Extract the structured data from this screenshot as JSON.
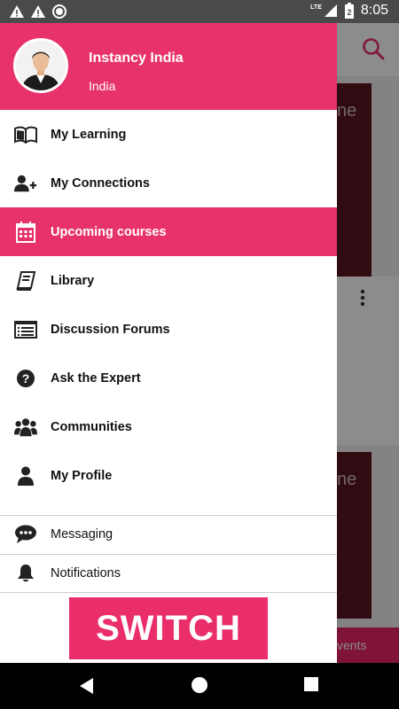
{
  "status_bar": {
    "time": "8:05",
    "network": "LTE",
    "battery_level_label": "2"
  },
  "user": {
    "name": "Instancy India",
    "location": "India"
  },
  "menu": {
    "items": [
      {
        "label": "My Learning",
        "icon": "book-open-icon",
        "active": false
      },
      {
        "label": "My Connections",
        "icon": "add-user-icon",
        "active": false
      },
      {
        "label": "Upcoming courses",
        "icon": "calendar-icon",
        "active": true
      },
      {
        "label": "Library",
        "icon": "book-icon",
        "active": false
      },
      {
        "label": "Discussion Forums",
        "icon": "list-icon",
        "active": false
      },
      {
        "label": "Ask the Expert",
        "icon": "question-icon",
        "active": false
      },
      {
        "label": "Communities",
        "icon": "group-icon",
        "active": false
      },
      {
        "label": "My Profile",
        "icon": "person-icon",
        "active": false
      }
    ],
    "secondary": [
      {
        "label": "Messaging",
        "icon": "chat-bubble-icon"
      },
      {
        "label": "Notifications",
        "icon": "bell-icon"
      }
    ]
  },
  "footer": {
    "logo_text": "SWITCH"
  },
  "background": {
    "card1_text": "ne",
    "card2_text": "ne",
    "bottom_text": "vents"
  },
  "colors": {
    "accent": "#e8326b",
    "status_bar": "#4a4a4a"
  }
}
